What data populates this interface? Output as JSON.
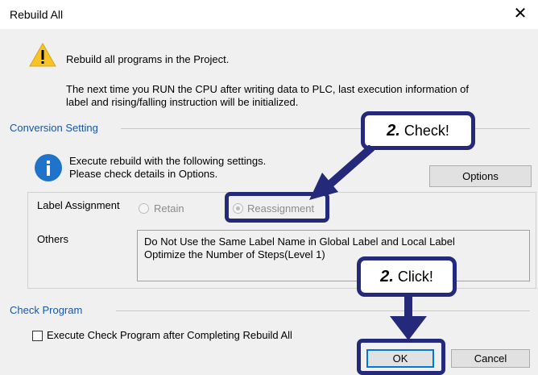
{
  "window": {
    "title": "Rebuild All",
    "close_symbol": "✕"
  },
  "message": {
    "line1": "Rebuild all programs in the Project.",
    "line2": "The next time you RUN the CPU after writing data to PLC, last execution information of",
    "line3": "label and rising/falling instruction will be initialized."
  },
  "conversion": {
    "group_title": "Conversion Setting",
    "info1": "Execute rebuild with the following settings.",
    "info2": "Please check details in Options.",
    "options_button": "Options",
    "label_assignment": "Label Assignment",
    "retain_label": "Retain",
    "reassignment_label": "Reassignment",
    "selected": "Reassignment",
    "others_label": "Others",
    "others_line1": "Do Not Use the Same Label Name in Global Label and Local Label",
    "others_line2": "Optimize the Number of Steps(Level 1)"
  },
  "check_program": {
    "group_title": "Check Program",
    "checkbox_label": "Execute Check Program after Completing Rebuild All",
    "checked": false
  },
  "buttons": {
    "ok": "OK",
    "cancel": "Cancel"
  },
  "annotations": {
    "check": {
      "num": "2.",
      "text": " Check!"
    },
    "click": {
      "num": "2.",
      "text": " Click!"
    }
  },
  "colors": {
    "annotation": "#24297a",
    "group_title": "#1a57a8",
    "info_icon": "#1f73c9",
    "warning_icon": "#f7c325"
  }
}
